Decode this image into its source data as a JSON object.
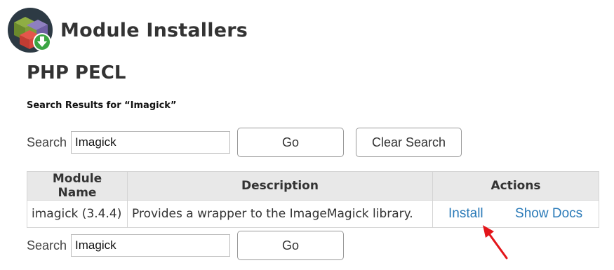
{
  "header": {
    "title": "Module Installers",
    "logo_icon": "module-cubes-download-icon"
  },
  "section": {
    "title": "PHP PECL",
    "results_heading": "Search Results for “Imagick”"
  },
  "search_top": {
    "label": "Search",
    "value": "Imagick",
    "go_label": "Go",
    "clear_label": "Clear Search"
  },
  "table": {
    "headers": {
      "name": "Module Name",
      "description": "Description",
      "actions": "Actions"
    },
    "rows": [
      {
        "name": "imagick (3.4.4)",
        "description": "Provides a wrapper to the ImageMagick library.",
        "install_label": "Install",
        "docs_label": "Show Docs"
      }
    ]
  },
  "search_bottom": {
    "label": "Search",
    "value": "Imagick",
    "go_label": "Go"
  },
  "annotation": {
    "arrow_icon": "red-arrow-icon",
    "arrow_color": "#e3151a"
  },
  "colors": {
    "link": "#2a7ab8",
    "header_bg": "#e8e8e8",
    "border": "#d4d4d4"
  }
}
